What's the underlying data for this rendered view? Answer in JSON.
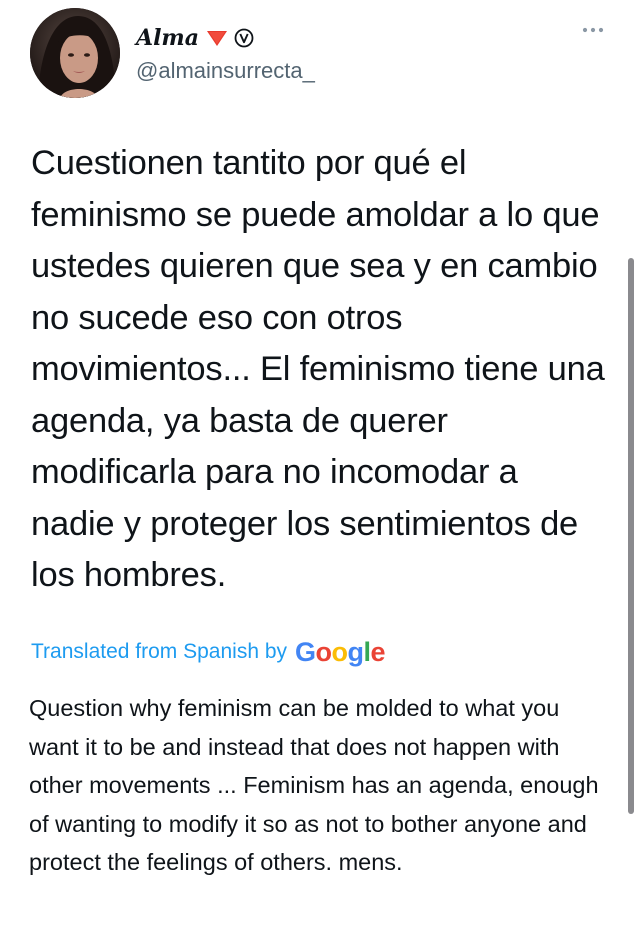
{
  "user": {
    "display_name": "Alma",
    "handle": "@almainsurrecta_",
    "badge_icon": "verified-v-circle-icon",
    "emoji_icon": "red-triangle-down-icon"
  },
  "menu": {
    "more_icon": "ellipsis-icon"
  },
  "tweet": {
    "text": "Cuestionen tantito por qué el feminismo se puede amoldar a lo que ustedes quieren que sea y en cambio no sucede eso con otros movimientos... El feminismo tiene una agenda, ya basta de querer modificarla para no incomodar a nadie y proteger los sentimientos de los hombres."
  },
  "translation": {
    "label": "Translated from Spanish by",
    "provider": [
      "G",
      "o",
      "o",
      "g",
      "l",
      "e"
    ],
    "provider_colors": [
      "#4285f4",
      "#ea4335",
      "#fbbc05",
      "#4285f4",
      "#34a853",
      "#ea4335"
    ],
    "text": "Question why feminism can be molded to what you want it to be and instead that does not happen with other movements ... Feminism has an agenda, enough of wanting to modify it so as not to bother anyone and protect the feelings of others. mens."
  },
  "colors": {
    "link": "#1d9bf0",
    "secondary_text": "#536471",
    "primary_text": "#0f1419"
  }
}
